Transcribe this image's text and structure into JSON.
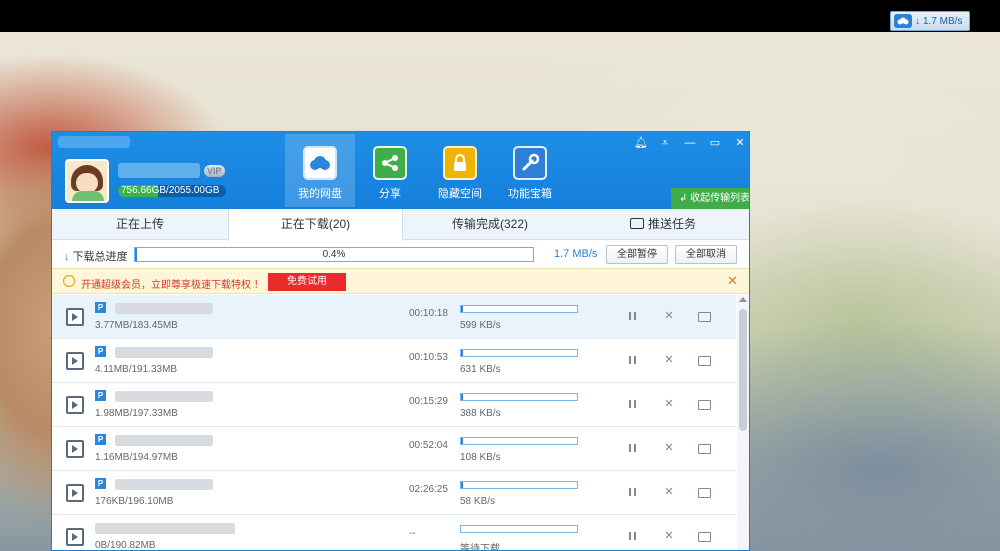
{
  "tray": {
    "speed": "1.7 MB/s"
  },
  "account": {
    "quota": "756.66GB/2055.00GB",
    "quota_fraction": 0.37,
    "vip_label": "VIP"
  },
  "nav": [
    {
      "label": "我的网盘"
    },
    {
      "label": "分享"
    },
    {
      "label": "隐藏空间"
    },
    {
      "label": "功能宝箱"
    }
  ],
  "transfer_list_label": "收起传输列表",
  "tabs": [
    {
      "label": "正在上传"
    },
    {
      "label": "正在下载(20)"
    },
    {
      "label": "传输完成(322)"
    },
    {
      "label": "推送任务"
    }
  ],
  "progress": {
    "label": "下载总进度",
    "percent_text": "0.4%",
    "percent": 0.4,
    "speed": "1.7 MB/s",
    "pause_all": "全部暂停",
    "cancel_all": "全部取消"
  },
  "promo": {
    "text": "开通超级会员，立即尊享极速下载特权 ！",
    "button": "免费试用"
  },
  "downloads": [
    {
      "size": "3.77MB/183.45MB",
      "time": "00:10:18",
      "speed": "599 KB/s",
      "progress": 0.02
    },
    {
      "size": "4.11MB/191.33MB",
      "time": "00:10:53",
      "speed": "631 KB/s",
      "progress": 0.02
    },
    {
      "size": "1.98MB/197.33MB",
      "time": "00:15:29",
      "speed": "388 KB/s",
      "progress": 0.01
    },
    {
      "size": "1.16MB/194.97MB",
      "time": "00:52:04",
      "speed": "108 KB/s",
      "progress": 0.006
    },
    {
      "size": "176KB/196.10MB",
      "time": "02:26:25",
      "speed": "58 KB/s",
      "progress": 0.001
    },
    {
      "size": "0B/190.82MB",
      "time": "--",
      "speed": "等待下载...",
      "progress": 0
    }
  ]
}
